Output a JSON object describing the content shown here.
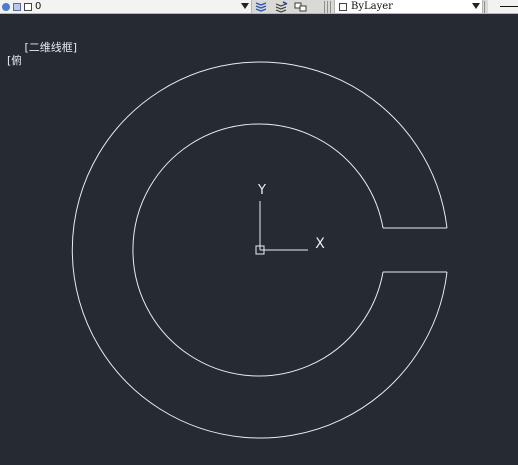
{
  "toolbar": {
    "layer": {
      "value": "0"
    },
    "linetype": {
      "value": "ByLayer"
    }
  },
  "viewport": {
    "view_label": "[俯视]",
    "visual_style_label": "[二维线框]"
  },
  "ucs": {
    "x_label": "X",
    "y_label": "Y"
  },
  "colors": {
    "canvas_bg": "#252a33",
    "geometry": "#e9edf2",
    "toolbar_bg": "#d9d9d6"
  },
  "icons": [
    "layer-state-icon",
    "layer-lock-icon",
    "layer-color-icon",
    "layer-properties-icon",
    "layer-isolate-icon",
    "layer-walk-icon",
    "linetype-swatch-icon",
    "dropdown-icon"
  ]
}
